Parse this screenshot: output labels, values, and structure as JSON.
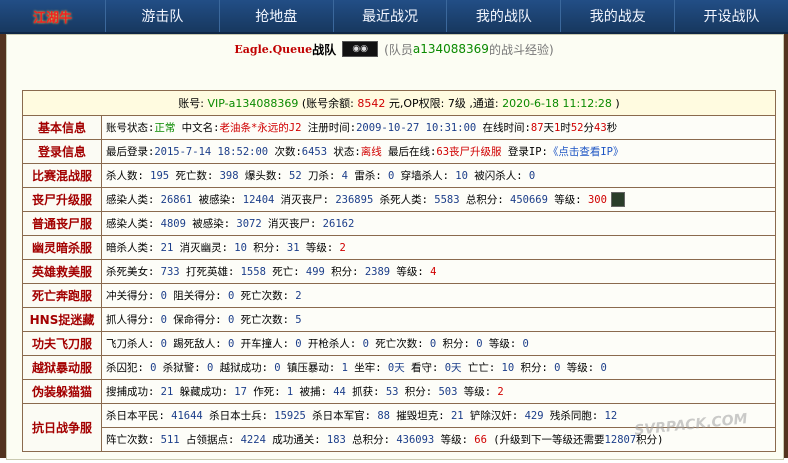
{
  "nav": {
    "logo": "江湖牛",
    "items": [
      "游击队",
      "抢地盘",
      "最近战况",
      "我的战队",
      "我的战友",
      "开设战队"
    ]
  },
  "header": {
    "team_name": "Eagle.Queue",
    "team_suffix": "战队",
    "team_image_alt": "◉◉",
    "member_prefix": "(队员",
    "member_id": "a134088369",
    "member_suffix": "的战斗经验)"
  },
  "summary": {
    "account_label": "账号:",
    "account_value": "VIP-a134088369",
    "balance_label": "(账号余额:",
    "balance_value": "8542",
    "op_label": "元,OP权限:",
    "op_value": "7级",
    "channel_label": ",通道:",
    "channel_value": "2020-6-18 11:12:28",
    "close": ")"
  },
  "rows": [
    {
      "label": "基本信息",
      "parts": [
        {
          "t": "账号状态:",
          "c": "k"
        },
        {
          "t": "正常",
          "c": "g"
        },
        {
          "t": " 中文名:",
          "c": "k"
        },
        {
          "t": "老油条*永远的J2",
          "c": "r"
        },
        {
          "t": " 注册时间:",
          "c": "k"
        },
        {
          "t": "2009-10-27 10:31:00",
          "c": "v"
        },
        {
          "t": " 在线时间:",
          "c": "k"
        },
        {
          "t": "87",
          "c": "r"
        },
        {
          "t": "天",
          "c": "k"
        },
        {
          "t": "1",
          "c": "r"
        },
        {
          "t": "时",
          "c": "k"
        },
        {
          "t": "52",
          "c": "r"
        },
        {
          "t": "分",
          "c": "k"
        },
        {
          "t": "43",
          "c": "r"
        },
        {
          "t": "秒",
          "c": "k"
        }
      ]
    },
    {
      "label": "登录信息",
      "parts": [
        {
          "t": "最后登录:",
          "c": "k"
        },
        {
          "t": "2015-7-14 18:52:00",
          "c": "v"
        },
        {
          "t": " 次数:",
          "c": "k"
        },
        {
          "t": "6453",
          "c": "v"
        },
        {
          "t": " 状态:",
          "c": "k"
        },
        {
          "t": "离线",
          "c": "r"
        },
        {
          "t": " 最后在线:",
          "c": "k"
        },
        {
          "t": "63丧尸升级服",
          "c": "r"
        },
        {
          "t": " 登录IP:",
          "c": "k"
        },
        {
          "t": "《点击查看IP》",
          "c": "link"
        }
      ]
    },
    {
      "label": "比赛混战服",
      "parts": [
        {
          "t": "杀人数:",
          "c": "k"
        },
        {
          "t": " 195",
          "c": "v"
        },
        {
          "t": " 死亡数:",
          "c": "k"
        },
        {
          "t": " 398",
          "c": "v"
        },
        {
          "t": " 爆头数:",
          "c": "k"
        },
        {
          "t": " 52",
          "c": "v"
        },
        {
          "t": " 刀杀:",
          "c": "k"
        },
        {
          "t": " 4",
          "c": "v"
        },
        {
          "t": " 雷杀:",
          "c": "k"
        },
        {
          "t": " 0",
          "c": "v"
        },
        {
          "t": " 穿墙杀人:",
          "c": "k"
        },
        {
          "t": " 10",
          "c": "v"
        },
        {
          "t": " 被闪杀人:",
          "c": "k"
        },
        {
          "t": " 0",
          "c": "v"
        }
      ]
    },
    {
      "label": "丧尸升级服",
      "avatar": true,
      "parts": [
        {
          "t": "感染人类:",
          "c": "k"
        },
        {
          "t": " 26861",
          "c": "v"
        },
        {
          "t": " 被感染:",
          "c": "k"
        },
        {
          "t": " 12404",
          "c": "v"
        },
        {
          "t": " 消灭丧尸:",
          "c": "k"
        },
        {
          "t": " 236895",
          "c": "v"
        },
        {
          "t": " 杀死人类:",
          "c": "k"
        },
        {
          "t": " 5583",
          "c": "v"
        },
        {
          "t": " 总积分:",
          "c": "k"
        },
        {
          "t": " 450669",
          "c": "v"
        },
        {
          "t": " 等级:",
          "c": "k"
        },
        {
          "t": " 300",
          "c": "r"
        }
      ]
    },
    {
      "label": "普通丧尸服",
      "parts": [
        {
          "t": "感染人类:",
          "c": "k"
        },
        {
          "t": " 4809",
          "c": "v"
        },
        {
          "t": " 被感染:",
          "c": "k"
        },
        {
          "t": " 3072",
          "c": "v"
        },
        {
          "t": " 消灭丧尸:",
          "c": "k"
        },
        {
          "t": " 26162",
          "c": "v"
        }
      ]
    },
    {
      "label": "幽灵暗杀服",
      "parts": [
        {
          "t": "暗杀人类:",
          "c": "k"
        },
        {
          "t": " 21",
          "c": "v"
        },
        {
          "t": " 消灭幽灵:",
          "c": "k"
        },
        {
          "t": " 10",
          "c": "v"
        },
        {
          "t": " 积分:",
          "c": "k"
        },
        {
          "t": " 31",
          "c": "v"
        },
        {
          "t": " 等级:",
          "c": "k"
        },
        {
          "t": " 2",
          "c": "r"
        }
      ]
    },
    {
      "label": "英雄救美服",
      "parts": [
        {
          "t": "杀死美女:",
          "c": "k"
        },
        {
          "t": " 733",
          "c": "v"
        },
        {
          "t": " 打死英雄:",
          "c": "k"
        },
        {
          "t": " 1558",
          "c": "v"
        },
        {
          "t": " 死亡:",
          "c": "k"
        },
        {
          "t": " 499",
          "c": "v"
        },
        {
          "t": " 积分:",
          "c": "k"
        },
        {
          "t": " 2389",
          "c": "v"
        },
        {
          "t": " 等级:",
          "c": "k"
        },
        {
          "t": " 4",
          "c": "r"
        }
      ]
    },
    {
      "label": "死亡奔跑服",
      "parts": [
        {
          "t": "冲关得分:",
          "c": "k"
        },
        {
          "t": " 0",
          "c": "v"
        },
        {
          "t": " 阻关得分:",
          "c": "k"
        },
        {
          "t": " 0",
          "c": "v"
        },
        {
          "t": " 死亡次数:",
          "c": "k"
        },
        {
          "t": " 2",
          "c": "v"
        }
      ]
    },
    {
      "label": "HNS捉迷藏",
      "parts": [
        {
          "t": "抓人得分:",
          "c": "k"
        },
        {
          "t": " 0",
          "c": "v"
        },
        {
          "t": " 保命得分:",
          "c": "k"
        },
        {
          "t": " 0",
          "c": "v"
        },
        {
          "t": " 死亡次数:",
          "c": "k"
        },
        {
          "t": " 5",
          "c": "v"
        }
      ]
    },
    {
      "label": "功夫飞刀服",
      "parts": [
        {
          "t": "飞刀杀人:",
          "c": "k"
        },
        {
          "t": " 0",
          "c": "v"
        },
        {
          "t": " 踢死敌人:",
          "c": "k"
        },
        {
          "t": " 0",
          "c": "v"
        },
        {
          "t": " 开车撞人:",
          "c": "k"
        },
        {
          "t": " 0",
          "c": "v"
        },
        {
          "t": " 开枪杀人:",
          "c": "k"
        },
        {
          "t": " 0",
          "c": "v"
        },
        {
          "t": " 死亡次数:",
          "c": "k"
        },
        {
          "t": " 0",
          "c": "v"
        },
        {
          "t": " 积分:",
          "c": "k"
        },
        {
          "t": " 0",
          "c": "v"
        },
        {
          "t": " 等级:",
          "c": "k"
        },
        {
          "t": " 0",
          "c": "v"
        }
      ]
    },
    {
      "label": "越狱暴动服",
      "parts": [
        {
          "t": "杀囚犯:",
          "c": "k"
        },
        {
          "t": " 0",
          "c": "v"
        },
        {
          "t": " 杀狱警:",
          "c": "k"
        },
        {
          "t": " 0",
          "c": "v"
        },
        {
          "t": " 越狱成功:",
          "c": "k"
        },
        {
          "t": " 0",
          "c": "v"
        },
        {
          "t": " 镇压暴动:",
          "c": "k"
        },
        {
          "t": " 1",
          "c": "v"
        },
        {
          "t": " 坐牢:",
          "c": "k"
        },
        {
          "t": " 0天",
          "c": "v"
        },
        {
          "t": " 看守:",
          "c": "k"
        },
        {
          "t": " 0天",
          "c": "v"
        },
        {
          "t": " 亡亡:",
          "c": "k"
        },
        {
          "t": " 10",
          "c": "v"
        },
        {
          "t": " 积分:",
          "c": "k"
        },
        {
          "t": " 0",
          "c": "v"
        },
        {
          "t": " 等级:",
          "c": "k"
        },
        {
          "t": " 0",
          "c": "v"
        }
      ]
    },
    {
      "label": "伪装躲猫猫",
      "parts": [
        {
          "t": "搜捕成功:",
          "c": "k"
        },
        {
          "t": " 21",
          "c": "v"
        },
        {
          "t": " 躲藏成功:",
          "c": "k"
        },
        {
          "t": " 17",
          "c": "v"
        },
        {
          "t": " 作死:",
          "c": "k"
        },
        {
          "t": " 1",
          "c": "v"
        },
        {
          "t": " 被捕:",
          "c": "k"
        },
        {
          "t": " 44",
          "c": "v"
        },
        {
          "t": " 抓获:",
          "c": "k"
        },
        {
          "t": " 53",
          "c": "v"
        },
        {
          "t": " 积分:",
          "c": "k"
        },
        {
          "t": " 503",
          "c": "v"
        },
        {
          "t": " 等级:",
          "c": "k"
        },
        {
          "t": " 2",
          "c": "r"
        }
      ]
    },
    {
      "label": "抗日战争服",
      "two_line": true,
      "parts": [
        {
          "t": "杀日本平民:",
          "c": "k"
        },
        {
          "t": " 41644",
          "c": "v"
        },
        {
          "t": " 杀日本士兵:",
          "c": "k"
        },
        {
          "t": " 15925",
          "c": "v"
        },
        {
          "t": " 杀日本军官:",
          "c": "k"
        },
        {
          "t": " 88",
          "c": "v"
        },
        {
          "t": " 摧毁坦克:",
          "c": "k"
        },
        {
          "t": " 21",
          "c": "v"
        },
        {
          "t": " 铲除汉奸:",
          "c": "k"
        },
        {
          "t": " 429",
          "c": "v"
        },
        {
          "t": " 残杀同胞:",
          "c": "k"
        },
        {
          "t": " 12",
          "c": "v"
        }
      ],
      "parts2": [
        {
          "t": "阵亡次数:",
          "c": "k"
        },
        {
          "t": " 511",
          "c": "v"
        },
        {
          "t": " 占领据点:",
          "c": "k"
        },
        {
          "t": " 4224",
          "c": "v"
        },
        {
          "t": " 成功通关:",
          "c": "k"
        },
        {
          "t": " 183",
          "c": "v"
        },
        {
          "t": " 总积分:",
          "c": "k"
        },
        {
          "t": " 436093",
          "c": "v"
        },
        {
          "t": " 等级:",
          "c": "k"
        },
        {
          "t": " 66",
          "c": "r"
        },
        {
          "t": " (升级到下一等级还需要",
          "c": "k"
        },
        {
          "t": "12807",
          "c": "v"
        },
        {
          "t": "积分)",
          "c": "k"
        }
      ]
    }
  ],
  "watermark": "SVRPACK.COM"
}
